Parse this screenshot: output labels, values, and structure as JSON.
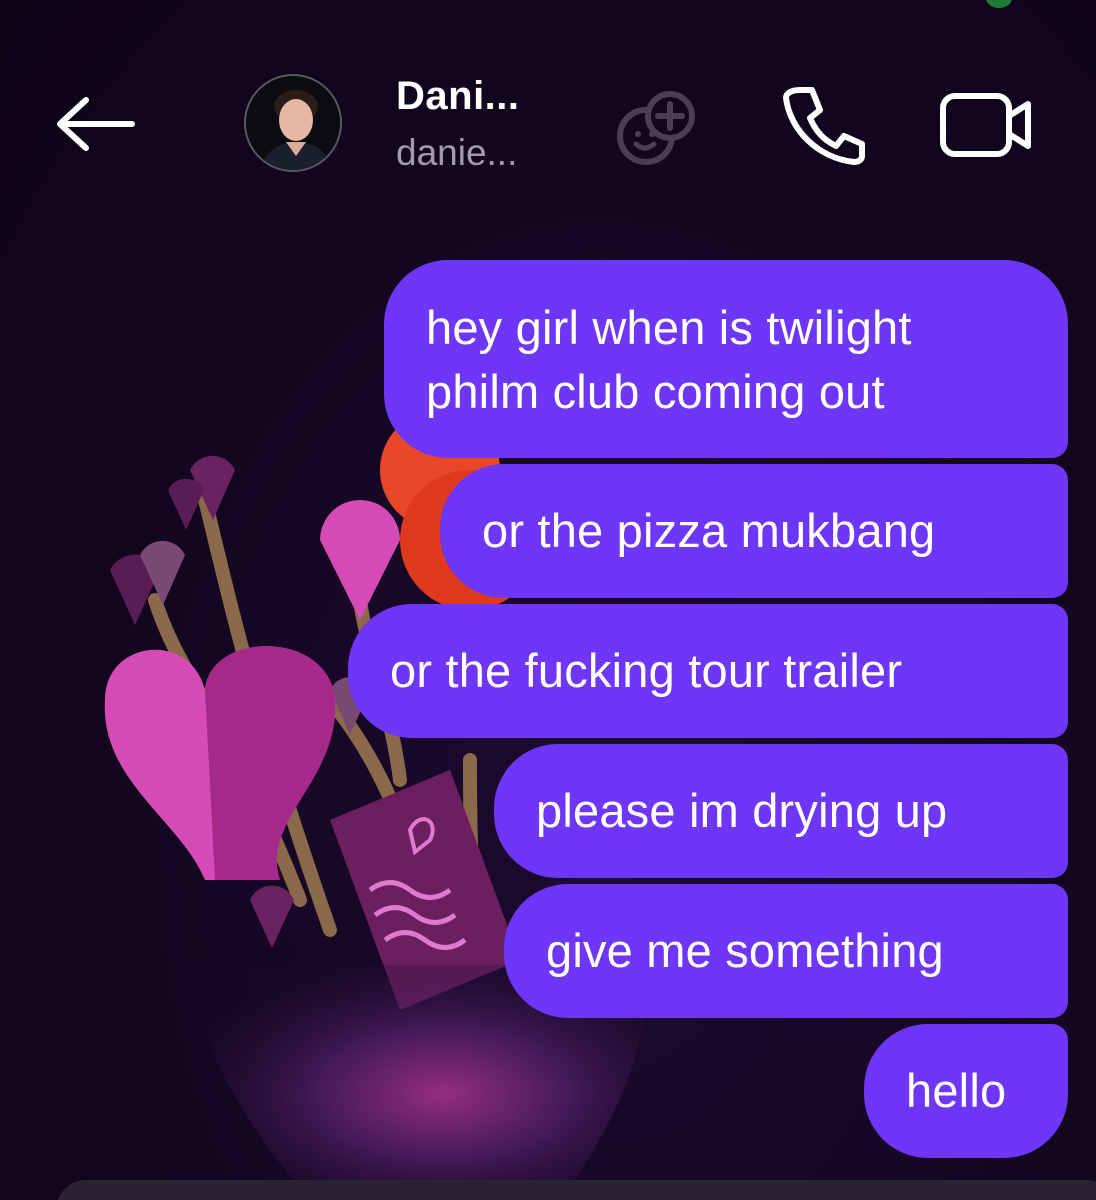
{
  "header": {
    "contact_name": "Dani...",
    "contact_handle": "danie..."
  },
  "icons": {
    "back": "arrow-left-icon",
    "avatar": "profile-photo",
    "add_effect": "add-people-icon",
    "call": "phone-icon",
    "video": "video-camera-icon"
  },
  "theme": {
    "bubble_color": "#6e36f6",
    "background": "#12061f"
  },
  "messages": [
    {
      "sender": "me",
      "text": "hey girl when is twilight philm club coming out"
    },
    {
      "sender": "me",
      "text": "or the pizza mukbang"
    },
    {
      "sender": "me",
      "text": "or the fucking tour trailer"
    },
    {
      "sender": "me",
      "text": "please im drying up"
    },
    {
      "sender": "me",
      "text": "give me something"
    },
    {
      "sender": "me",
      "text": "hello"
    }
  ]
}
